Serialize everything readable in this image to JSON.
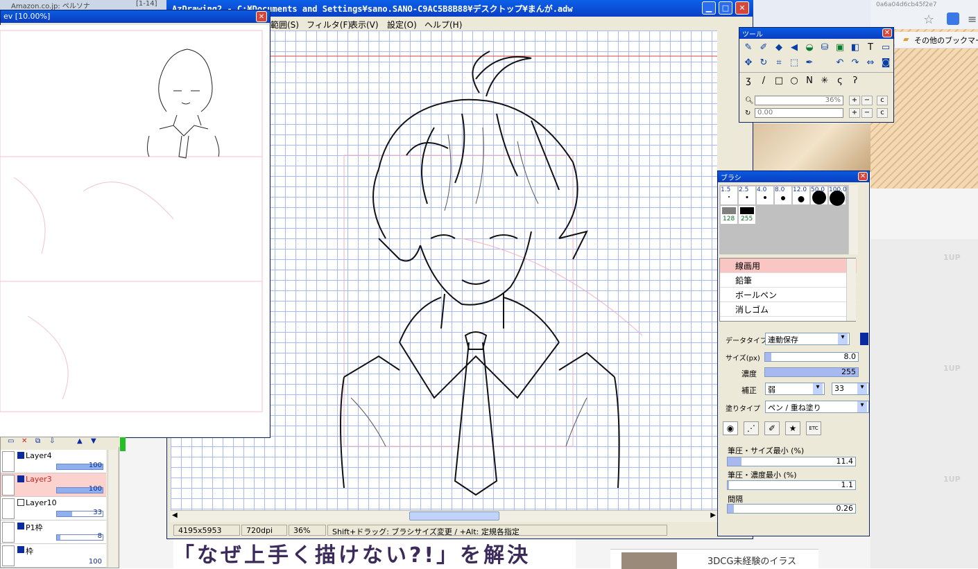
{
  "browser": {
    "tabs": [
      "Amazon.co.jp: ペルソナ",
      "[1-14]"
    ],
    "bookmarks_label": "その他のブックマーク",
    "hash_text": "0a6a04d6cb45f2e7",
    "banner_text": "「なぜ上手く描けない?!」を解決",
    "side_card_text": "3DCG未経験のイラス",
    "tile_label": "1UP"
  },
  "preview": {
    "title": "ev [10.00%]"
  },
  "app": {
    "title": "AzDrawing2 - C:¥Documents and Settings¥sano.SANO-C9AC5B8B88¥デスクトップ¥まんが.adw",
    "menu": [
      "範囲(S)",
      "フィルタ(F)",
      "表示(V)",
      "設定(O)",
      "ヘルプ(H)"
    ],
    "status": {
      "size": "4195x5953",
      "dpi": "720dpi",
      "zoom": "36%",
      "hint": "Shift+ドラッグ: ブラシサイズ変更 / +Alt: 定規各指定"
    }
  },
  "layers": [
    {
      "name": "Layer4",
      "opacity": "100",
      "selected": false
    },
    {
      "name": "Layer3",
      "opacity": "100",
      "selected": true
    },
    {
      "name": "Layer10",
      "opacity": "33",
      "selected": false
    },
    {
      "name": "P1枠",
      "opacity": "8",
      "selected": false
    },
    {
      "name": "枠",
      "opacity": "100",
      "selected": false
    }
  ],
  "tool": {
    "title": "ツール",
    "zoom_value": "36%",
    "rotate_value": "0.00",
    "plus": "+",
    "minus": "−",
    "c": "c"
  },
  "brush": {
    "title": "ブラシ",
    "sizes": [
      "1.5",
      "2.5",
      "4.0",
      "8.0",
      "12.0",
      "50.0",
      "100.0"
    ],
    "colors": [
      "128",
      "255"
    ],
    "list": [
      "線画用",
      "鉛筆",
      "ボールペン",
      "消しゴム"
    ],
    "datatype_label": "データタイプ",
    "datatype_value": "連動保存",
    "size_label": "サイズ(px)",
    "size_value": "8.0",
    "density_label": "濃度",
    "density_value": "255",
    "correction_label": "補正",
    "correction_value": "弱",
    "correction_num": "33",
    "paint_label": "塗りタイプ",
    "paint_value": "ペン / 重ね塗り",
    "pressure_size_label": "筆圧・サイズ最小 (%)",
    "pressure_size_value": "11.4",
    "pressure_density_label": "筆圧・濃度最小 (%)",
    "pressure_density_value": "1.1",
    "interval_label": "間隔",
    "interval_value": "0.26",
    "etc_label": "ETC"
  },
  "colors": {
    "titlebar": "#0a46d6",
    "grid": "#a9b9f3",
    "selection": "#f9c6c4"
  }
}
